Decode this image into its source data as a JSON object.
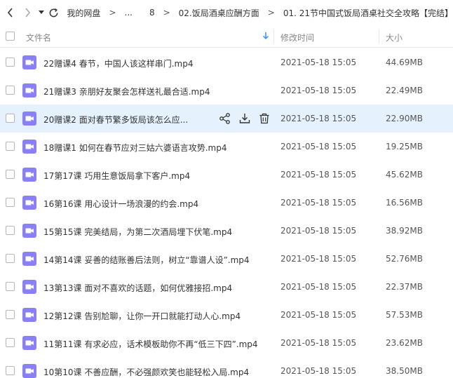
{
  "breadcrumb": {
    "items": [
      "我的网盘",
      "...",
      "8",
      "02.饭局酒桌应酬方面",
      "01. 21节中国式饭局酒桌社交全攻略【完结】"
    ],
    "separator": ">"
  },
  "header": {
    "name_label": "文件名",
    "time_label": "修改时间",
    "size_label": "大小",
    "sort_icon": "arrow-down-icon"
  },
  "colors": {
    "accent": "#3b8cf5",
    "file_icon": "#8a80f5",
    "highlight_row": "#e5f2fd"
  },
  "row_actions": [
    "share-icon",
    "download-icon",
    "delete-icon"
  ],
  "files": [
    {
      "name": "22赠课4 春节，中国人该这样串门.mp4",
      "time": "2021-05-18 15:05",
      "size": "44.69MB"
    },
    {
      "name": "21赠课3 亲朋好友聚会怎样送礼最合适.mp4",
      "time": "2021-05-18 15:05",
      "size": "22.49MB"
    },
    {
      "name": "20赠课2 面对春节繁多饭局该怎么应...",
      "time": "2021-05-18 15:05",
      "size": "22.90MB"
    },
    {
      "name": "18赠课1 如何在春节应对三姑六婆语言攻势.mp4",
      "time": "2021-05-18 15:05",
      "size": "19.25MB"
    },
    {
      "name": "17第17课 巧用生意饭局拿下客户.mp4",
      "time": "2021-05-18 15:05",
      "size": "45.62MB"
    },
    {
      "name": "16第16课 用心设计一场浪漫的约会.mp4",
      "time": "2021-05-18 15:05",
      "size": "16.56MB"
    },
    {
      "name": "15第15课 完美结局，为第二次酒局埋下伏笔.mp4",
      "time": "2021-05-18 15:05",
      "size": "38.92MB"
    },
    {
      "name": "14第14课 妥善的结账善后法则，树立“靠谱人设”.mp4",
      "time": "2021-05-18 15:05",
      "size": "52.76MB"
    },
    {
      "name": "13第13课 面对不喜欢的话题，如何优雅接招.mp4",
      "time": "2021-05-18 15:05",
      "size": "22.37MB"
    },
    {
      "name": "12第12课 告别尬聊，让你一开口就能打动人心.mp4",
      "time": "2021-05-18 15:05",
      "size": "57.53MB"
    },
    {
      "name": "11第11课 有求必应，话术模板助你不再“低三下四”.mp4",
      "time": "2021-05-18 15:05",
      "size": "23.62MB"
    },
    {
      "name": "10第10课 不善应酬，不必强颜欢笑也能轻松入局.mp4",
      "time": "2021-05-18 15:05",
      "size": "38.50MB"
    }
  ]
}
